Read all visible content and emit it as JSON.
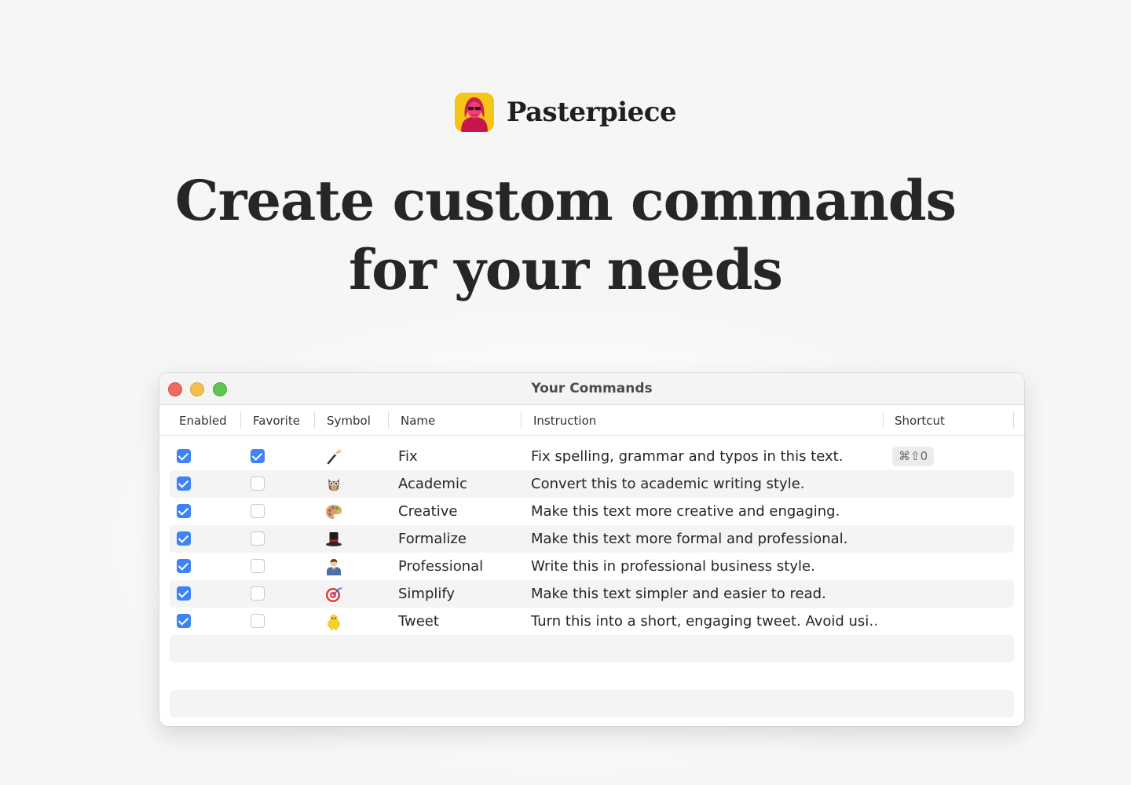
{
  "brand": {
    "name": "Pasterpiece"
  },
  "headline": {
    "line1": "Create custom commands",
    "line2": "for your needs"
  },
  "window": {
    "title": "Your Commands",
    "columns": [
      "Enabled",
      "Favorite",
      "Symbol",
      "Name",
      "Instruction",
      "Shortcut"
    ],
    "rows": [
      {
        "enabled": true,
        "favorite": true,
        "symbol": "magic-wand-icon",
        "name": "Fix",
        "instruction": "Fix spelling, grammar and typos in this text.",
        "shortcut": "⌘⇧0"
      },
      {
        "enabled": true,
        "favorite": false,
        "symbol": "owl-icon",
        "name": "Academic",
        "instruction": "Convert this to academic writing style.",
        "shortcut": ""
      },
      {
        "enabled": true,
        "favorite": false,
        "symbol": "palette-icon",
        "name": "Creative",
        "instruction": "Make this text more creative and engaging.",
        "shortcut": ""
      },
      {
        "enabled": true,
        "favorite": false,
        "symbol": "top-hat-icon",
        "name": "Formalize",
        "instruction": "Make this text more formal and professional.",
        "shortcut": ""
      },
      {
        "enabled": true,
        "favorite": false,
        "symbol": "businessperson-icon",
        "name": "Professional",
        "instruction": "Write this in professional business style.",
        "shortcut": ""
      },
      {
        "enabled": true,
        "favorite": false,
        "symbol": "target-icon",
        "name": "Simplify",
        "instruction": "Make this text simpler and easier to read.",
        "shortcut": ""
      },
      {
        "enabled": true,
        "favorite": false,
        "symbol": "chick-icon",
        "name": "Tweet",
        "instruction": "Turn this into a short, engaging tweet. Avoid usi…",
        "shortcut": ""
      }
    ]
  },
  "colors": {
    "accent_checkbox": "#3d82f6",
    "traffic_red": "#ed6a5e",
    "traffic_yellow": "#f5bf4f",
    "traffic_green": "#61c554",
    "logo_background": "#f5c518",
    "logo_figure": "#e0245e"
  }
}
